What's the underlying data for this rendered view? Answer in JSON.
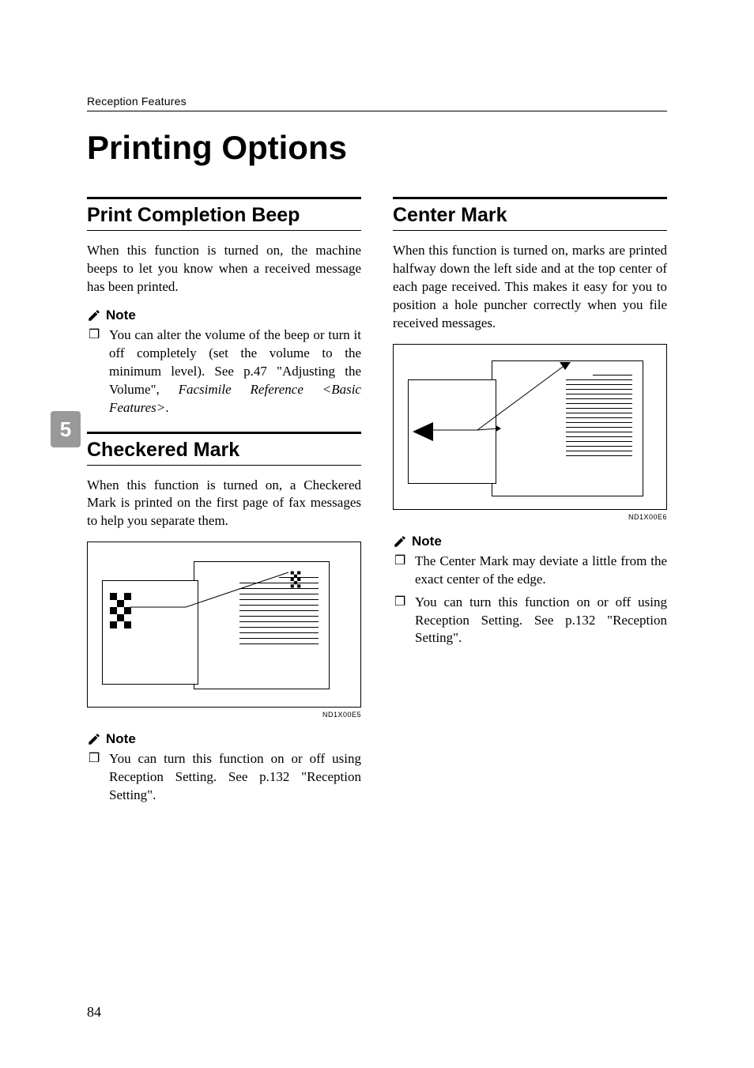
{
  "running_head": "Reception Features",
  "page_title": "Printing Options",
  "chapter_tab": "5",
  "page_number": "84",
  "sec1": {
    "title": "Print Completion Beep",
    "body": "When this function is turned on, the machine beeps to let you know when a received message has been printed.",
    "note_label": "Note",
    "note_item_plain": "You can alter the volume of the beep or turn it off completely (set the volume to the minimum level). See p.47 \"Adjusting the Volume\", ",
    "note_item_italic": "Facsimile Reference <Basic Features>",
    "note_item_tail": "."
  },
  "sec2": {
    "title": "Checkered Mark",
    "body": "When this function is turned on, a Checkered Mark is printed on the first page of fax messages to help you separate them.",
    "fig_label": "ND1X00E5",
    "note_label": "Note",
    "note_item": "You can turn this function on or off using Reception Setting. See p.132 \"Reception Setting\"."
  },
  "sec3": {
    "title": "Center Mark",
    "body": "When this function is turned on, marks are printed halfway down the left side and at the top center of each page received. This makes it easy for you to position a hole puncher correctly when you file received messages.",
    "fig_label": "ND1X00E6",
    "note_label": "Note",
    "note_item1": "The Center Mark may deviate a little from the exact center of the edge.",
    "note_item2": "You can turn this function on or off using Reception Setting. See p.132 \"Reception Setting\"."
  }
}
